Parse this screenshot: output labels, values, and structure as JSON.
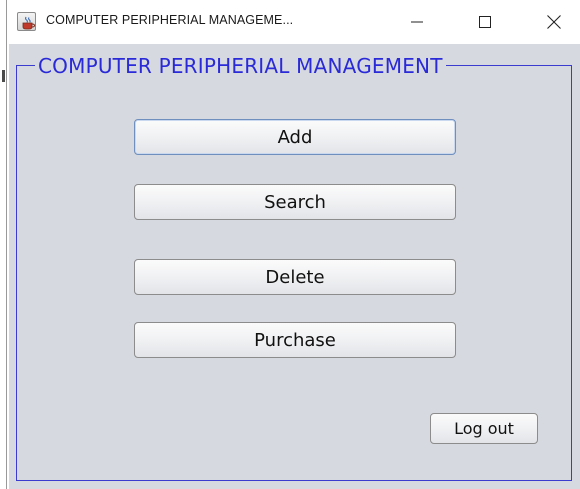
{
  "window": {
    "title": "COMPUTER PERIPHERIAL MANAGEME...",
    "icon": "java-cup-icon",
    "controls": [
      "minimize-icon",
      "maximize-icon",
      "close-icon"
    ]
  },
  "panel": {
    "title": "COMPUTER PERIPHERIAL MANAGEMENT",
    "title_color": "#2a2ad8",
    "border_color": "#3b3bcf",
    "background": "#d6d9df"
  },
  "buttons": {
    "add": "Add",
    "search": "Search",
    "delete": "Delete",
    "purchase": "Purchase",
    "logout": "Log out"
  }
}
